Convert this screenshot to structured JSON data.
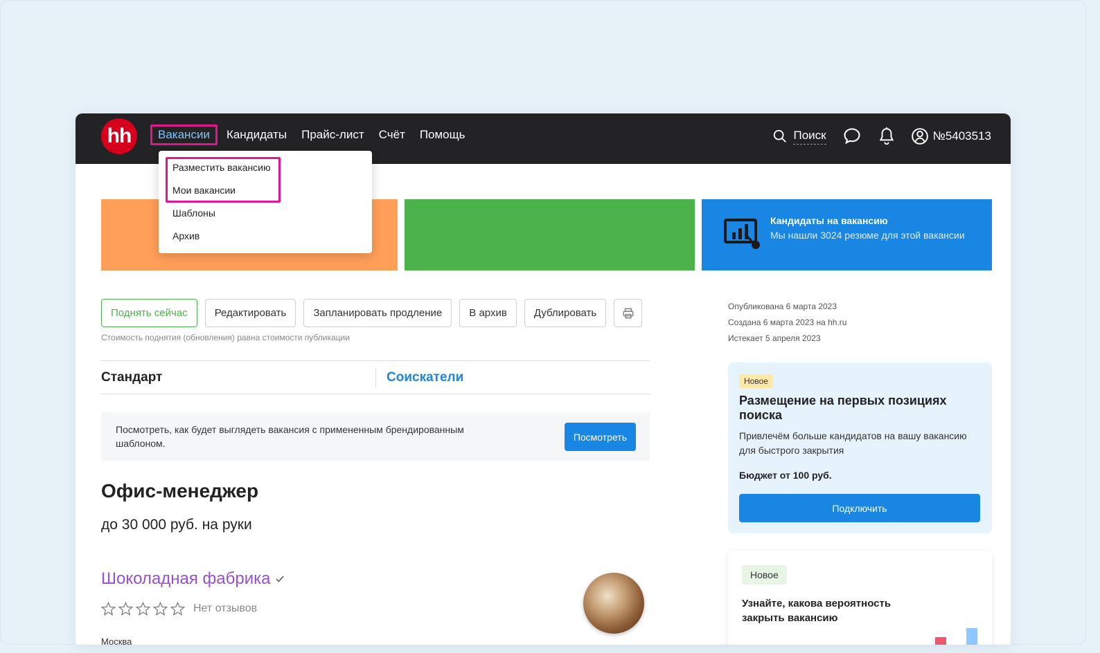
{
  "header": {
    "logo": "hh",
    "nav": [
      "Вакансии",
      "Кандидаты",
      "Прайс-лист",
      "Счёт",
      "Помощь"
    ],
    "search_label": "Поиск",
    "account": "№5403513"
  },
  "dropdown": {
    "items": [
      "Разместить вакансию",
      "Мои вакансии",
      "Шаблоны",
      "Архив"
    ]
  },
  "banner": {
    "title": "Кандидаты на вакансию",
    "text": "Мы нашли 3024 резюме для этой вакансии"
  },
  "actions": {
    "buttons": [
      "Поднять сейчас",
      "Редактировать",
      "Запланировать продление",
      "В архив",
      "Дублировать"
    ],
    "hint": "Стоимость поднятия (обновления) равна стоимости публикации"
  },
  "tabs": {
    "standard": "Стандарт",
    "applicants": "Соискатели"
  },
  "preview": {
    "text": "Посмотреть, как будет выглядеть вакансия с примененным брендированным шаблоном.",
    "button": "Посмотреть"
  },
  "vacancy": {
    "title": "Офис-менеджер",
    "salary": "до 30 000 руб. на руки",
    "company": "Шоколадная фабрика",
    "reviews": "Нет отзывов",
    "rating_stars": 0,
    "city": "Москва"
  },
  "meta": {
    "published": "Опубликована 6 марта 2023",
    "created": "Создана 6 марта 2023 на hh.ru",
    "expires": "Истекает 5 апреля 2023"
  },
  "promo1": {
    "badge": "Новое",
    "title": "Размещение на первых позициях поиска",
    "text": "Привлечём больше кандидатов на вашу вакансию для быстрого закрытия",
    "budget": "Бюджет от 100 руб.",
    "button": "Подключить"
  },
  "promo2": {
    "badge": "Новое",
    "title": "Узнайте, какова вероятность закрыть вакансию"
  },
  "colors": {
    "header_bg": "#232325",
    "brand_red": "#d6001c",
    "accent_blue": "#1a86e4",
    "highlight_pink": "#e2178e",
    "green": "#4cb34c",
    "orange": "#ff9f5a",
    "company_purple": "#9a4fcc"
  }
}
